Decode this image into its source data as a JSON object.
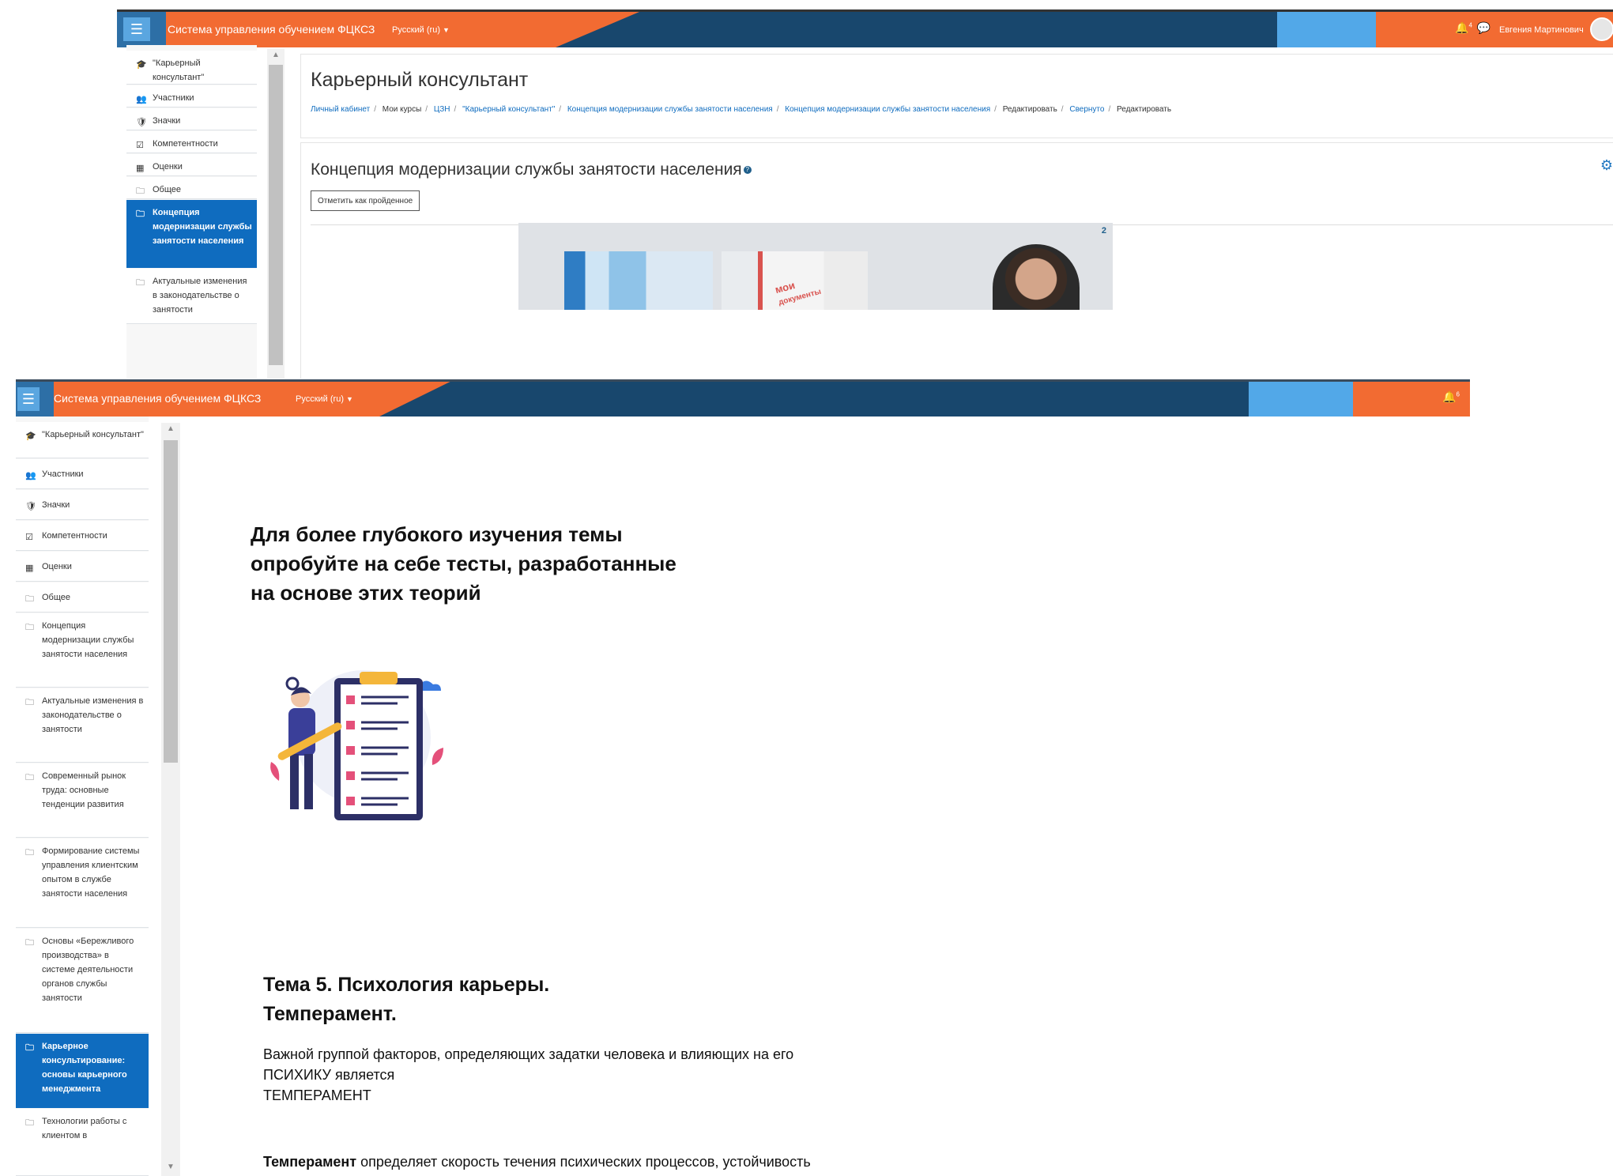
{
  "navbar": {
    "brand_part1": "Система",
    "brand_part2": "управления обучением ФЦКСЗ",
    "language": "Русский (ru)",
    "menu_icon": "hamburger-icon",
    "bell_icon": "bell-icon",
    "bell_badge": "4",
    "chat_icon": "chat-icon",
    "user_name": "Евгения Мартинович",
    "colors": {
      "orange": "#f26b32",
      "navy": "#18476d",
      "light_blue": "#52a8e8"
    }
  },
  "drawer_top": {
    "items": [
      {
        "icon": "graduation-cap-icon",
        "label": "\"Карьерный консультант\""
      },
      {
        "icon": "users-icon",
        "label": "Участники"
      },
      {
        "icon": "shield-icon",
        "label": "Значки"
      },
      {
        "icon": "check-square-icon",
        "label": "Компетентности"
      },
      {
        "icon": "table-icon",
        "label": "Оценки"
      },
      {
        "icon": "folder-icon",
        "label": "Общее"
      },
      {
        "icon": "folder-icon",
        "label": "Концепция модернизации службы занятости населения",
        "active": true
      },
      {
        "icon": "folder-icon",
        "label": "Актуальные изменения в законодательстве о занятости"
      }
    ]
  },
  "page_header": {
    "course_title": "Карьерный консультант",
    "breadcrumbs": [
      {
        "label": "Личный кабинет",
        "link": true
      },
      {
        "label": "Мои курсы",
        "link": false
      },
      {
        "label": "ЦЗН",
        "link": true
      },
      {
        "label": "\"Карьерный консультант\"",
        "link": true
      },
      {
        "label": "Концепция модернизации службы занятости населения",
        "link": true
      },
      {
        "label": "Концепция модернизации службы занятости населения",
        "link": true
      },
      {
        "label": "Редактировать",
        "link": false
      },
      {
        "label": "Свернуто",
        "link": true
      },
      {
        "label": "Редактировать",
        "link": false
      }
    ]
  },
  "activity": {
    "title": "Концепция модернизации службы занятости населения",
    "help_icon": "question-circle-icon",
    "mark_done_label": "Отметить как пройденное",
    "settings_icon": "gear-icon",
    "video_page_number": "2",
    "video_logo_text_1": "мои",
    "video_logo_text_2": "документы"
  },
  "navbar2": {
    "bell_badge": "6"
  },
  "drawer_bottom": {
    "items": [
      {
        "icon": "graduation-cap-icon",
        "label": "\"Карьерный консультант\""
      },
      {
        "icon": "users-icon",
        "label": "Участники"
      },
      {
        "icon": "shield-icon",
        "label": "Значки"
      },
      {
        "icon": "check-square-icon",
        "label": "Компетентности"
      },
      {
        "icon": "table-icon",
        "label": "Оценки"
      },
      {
        "icon": "folder-icon",
        "label": "Общее"
      },
      {
        "icon": "folder-icon",
        "label": "Концепция модернизации службы занятости населения"
      },
      {
        "icon": "folder-icon",
        "label": "Актуальные изменения в законодательстве о занятости"
      },
      {
        "icon": "folder-icon",
        "label": "Современный рынок труда: основные тенденции развития"
      },
      {
        "icon": "folder-icon",
        "label": "Формирование системы управления клиентским опытом в службе занятости населения"
      },
      {
        "icon": "folder-icon",
        "label": "Основы «Бережливого производства» в системе деятельности органов службы занятости"
      },
      {
        "icon": "folder-icon",
        "label": "Карьерное консультирование: основы карьерного менеджмента",
        "active": true
      },
      {
        "icon": "folder-icon",
        "label": "Технологии работы с клиентом в"
      }
    ]
  },
  "slide": {
    "heading_line1": "Для более глубокого изучения темы",
    "heading_line2": "опробуйте на себе тесты, разработанные",
    "heading_line3": "на основе этих теорий",
    "illustration": "checklist-illustration",
    "topic_line1": "Тема 5. Психология карьеры.",
    "topic_line2": "Темперамент.",
    "para1_line1": "Важной группой факторов, определяющих задатки человека и влияющих на его",
    "para1_line2": "ПСИХИКУ является",
    "para1_line3": "ТЕМПЕРАМЕНТ",
    "para2_bold": "Темперамент",
    "para2_rest": " определяет скорость течения психических процессов, устойчивость"
  }
}
